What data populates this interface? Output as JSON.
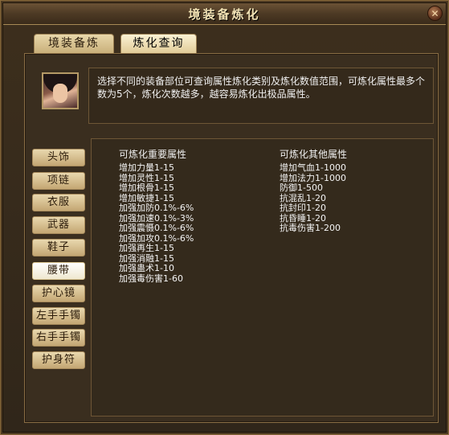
{
  "window": {
    "title": "境装备炼化",
    "close_label": "✕"
  },
  "tabs": [
    {
      "label": "境装备炼化",
      "active": false
    },
    {
      "label": "炼化查询",
      "active": true
    }
  ],
  "description": "选择不同的装备部位可查询属性炼化类别及炼化数值范围，可炼化属性最多个数为5个，炼化次数越多，越容易炼化出极品属性。",
  "categories": [
    "头饰",
    "项链",
    "衣服",
    "武器",
    "鞋子",
    "腰带",
    "护心镜",
    "左手手镯",
    "右手手镯",
    "护身符"
  ],
  "selected_category": "腰带",
  "main_attrs": {
    "title": "可炼化重要属性",
    "items": [
      "增加力量1-15",
      "增加灵性1-15",
      "增加根骨1-15",
      "增加敏捷1-15",
      "加强加防0.1%-6%",
      "加强加速0.1%-3%",
      "加强震慑0.1%-6%",
      "加强加攻0.1%-6%",
      "加强再生1-15",
      "加强消融1-15",
      "加强蛊术1-10",
      "加强毒伤害1-60"
    ]
  },
  "other_attrs": {
    "title": "可炼化其他属性",
    "items": [
      "增加气血1-1000",
      "增加法力1-1000",
      "防御1-500",
      "抗混乱1-20",
      "抗封印1-20",
      "抗昏睡1-20",
      "抗毒伤害1-200"
    ]
  }
}
